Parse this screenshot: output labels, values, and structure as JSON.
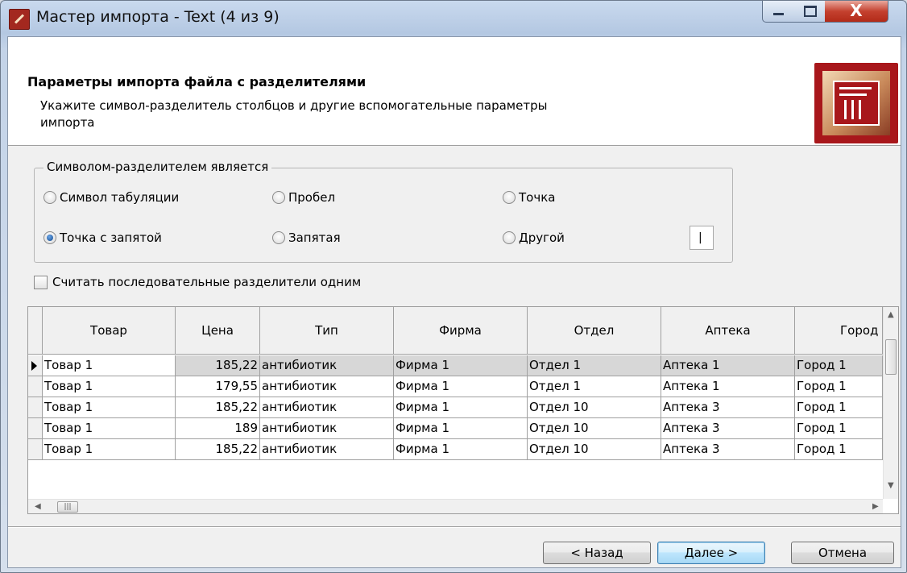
{
  "window": {
    "title": "Мастер импорта - Text (4 из 9)",
    "close_glyph": "X"
  },
  "header": {
    "title": "Параметры импорта файла с разделителями",
    "description": "Укажите символ-разделитель столбцов и другие вспомогательные параметры импорта"
  },
  "delimiter_group": {
    "title": "Символом-разделителем является",
    "options": [
      {
        "label": "Символ табуляции",
        "selected": false
      },
      {
        "label": "Пробел",
        "selected": false
      },
      {
        "label": "Точка",
        "selected": false
      },
      {
        "label": "Точка с запятой",
        "selected": true
      },
      {
        "label": "Запятая",
        "selected": false
      },
      {
        "label": "Другой",
        "selected": false
      }
    ],
    "other_value": "|"
  },
  "consecutive_checkbox": {
    "label": "Считать последовательные разделители одним",
    "checked": false
  },
  "preview": {
    "columns": [
      "Товар",
      "Цена",
      "Тип",
      "Фирма",
      "Отдел",
      "Аптека",
      "Город"
    ],
    "rows": [
      [
        "Товар 1",
        "185,22",
        "антибиотик",
        "Фирма 1",
        "Отдел 1",
        "Аптека 1",
        "Город 1"
      ],
      [
        "Товар 1",
        "179,55",
        "антибиотик",
        "Фирма 1",
        "Отдел 1",
        "Аптека 1",
        "Город 1"
      ],
      [
        "Товар 1",
        "185,22",
        "антибиотик",
        "Фирма 1",
        "Отдел 10",
        "Аптека 3",
        "Город 1"
      ],
      [
        "Товар 1",
        "189",
        "антибиотик",
        "Фирма 1",
        "Отдел 10",
        "Аптека 3",
        "Город 1"
      ],
      [
        "Товар 1",
        "185,22",
        "антибиотик",
        "Фирма 1",
        "Отдел 10",
        "Аптека 3",
        "Город 1"
      ]
    ],
    "selected_row": 0
  },
  "buttons": {
    "back": "< Назад",
    "next": "Далее >",
    "cancel": "Отмена"
  }
}
